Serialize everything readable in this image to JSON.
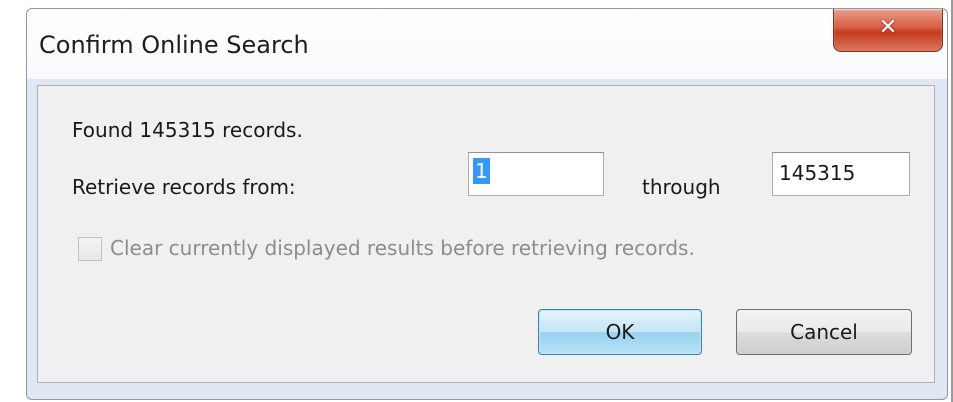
{
  "window": {
    "title": "Confirm Online Search",
    "close_icon": "close-icon"
  },
  "dialog": {
    "found_text": "Found 145315 records.",
    "retrieve_label": "Retrieve records from:",
    "from_value": "1",
    "through_label": "through",
    "to_value": "145315",
    "clear_checkbox": {
      "label": "Clear currently displayed results before retrieving records.",
      "checked": false,
      "enabled": false
    },
    "ok_label": "OK",
    "cancel_label": "Cancel"
  },
  "colors": {
    "close_button": "#d75c40",
    "selection": "#3399ff",
    "ok_button": "#c4e5f6",
    "disabled_text": "#8d8d8d"
  }
}
